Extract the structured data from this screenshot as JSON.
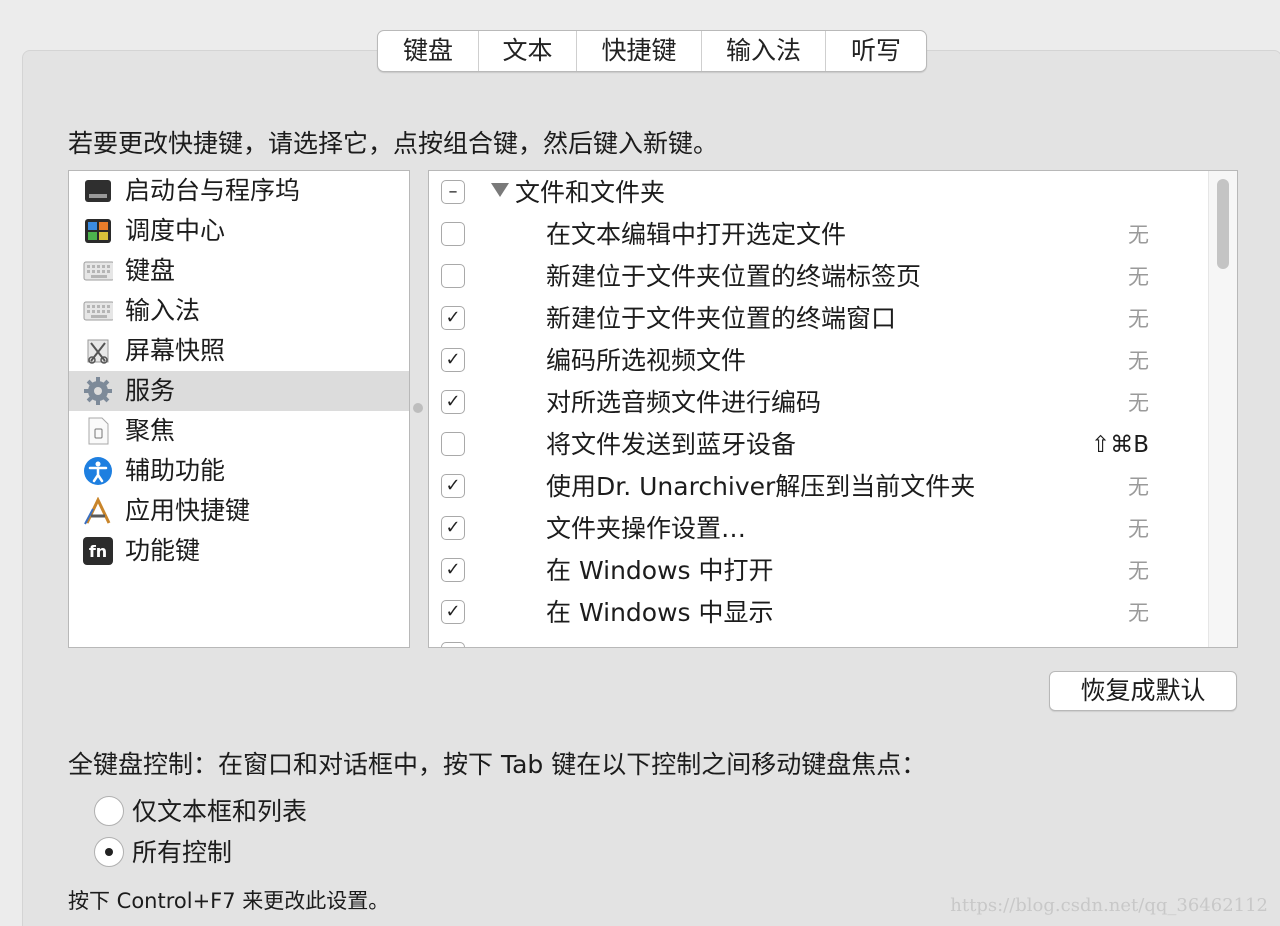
{
  "tabs": [
    {
      "label": "键盘",
      "selected": false
    },
    {
      "label": "文本",
      "selected": false
    },
    {
      "label": "快捷键",
      "selected": true
    },
    {
      "label": "输入法",
      "selected": false
    },
    {
      "label": "听写",
      "selected": false
    }
  ],
  "instruction": "若要更改快捷键，请选择它，点按组合键，然后键入新键。",
  "categories": [
    {
      "label": "启动台与程序坞",
      "icon": "launchpad-dock-icon",
      "icon_color": "#333333",
      "selected": false
    },
    {
      "label": "调度中心",
      "icon": "mission-control-icon",
      "icon_color": "#2e2e2e",
      "selected": false
    },
    {
      "label": "键盘",
      "icon": "keyboard-icon",
      "icon_color": "#c9c9c9",
      "selected": false
    },
    {
      "label": "输入法",
      "icon": "input-method-icon",
      "icon_color": "#c9c9c9",
      "selected": false
    },
    {
      "label": "屏幕快照",
      "icon": "screenshot-icon",
      "icon_color": "#b0b0b0",
      "selected": false
    },
    {
      "label": "服务",
      "icon": "gear-icon",
      "icon_color": "#8a8a8a",
      "selected": true
    },
    {
      "label": "聚焦",
      "icon": "spotlight-icon",
      "icon_color": "#dddddd",
      "selected": false
    },
    {
      "label": "辅助功能",
      "icon": "accessibility-icon",
      "icon_color": "#1e7fe0",
      "selected": false
    },
    {
      "label": "应用快捷键",
      "icon": "app-shortcuts-icon",
      "icon_color": "#e0a030",
      "selected": false
    },
    {
      "label": "功能键",
      "icon": "fn-key-icon",
      "icon_color": "#2c2c2c",
      "selected": false
    }
  ],
  "services": {
    "group": {
      "label": "文件和文件夹",
      "state": "mixed",
      "expanded": true
    },
    "items": [
      {
        "label": "在文本编辑中打开选定文件",
        "checked": false,
        "shortcut": "无",
        "set": false
      },
      {
        "label": "新建位于文件夹位置的终端标签页",
        "checked": false,
        "shortcut": "无",
        "set": false
      },
      {
        "label": "新建位于文件夹位置的终端窗口",
        "checked": true,
        "shortcut": "无",
        "set": false
      },
      {
        "label": "编码所选视频文件",
        "checked": true,
        "shortcut": "无",
        "set": false
      },
      {
        "label": "对所选音频文件进行编码",
        "checked": true,
        "shortcut": "无",
        "set": false
      },
      {
        "label": "将文件发送到蓝牙设备",
        "checked": false,
        "shortcut": "⇧⌘B",
        "set": true
      },
      {
        "label": "使用Dr. Unarchiver解压到当前文件夹",
        "checked": true,
        "shortcut": "无",
        "set": false
      },
      {
        "label": "文件夹操作设置…",
        "checked": true,
        "shortcut": "无",
        "set": false
      },
      {
        "label": "在 Windows 中打开",
        "checked": true,
        "shortcut": "无",
        "set": false
      },
      {
        "label": "在 Windows 中显示",
        "checked": true,
        "shortcut": "无",
        "set": false
      }
    ]
  },
  "restore_button": "恢复成默认",
  "keyboard_control": {
    "title": "全键盘控制：在窗口和对话框中，按下 Tab 键在以下控制之间移动键盘焦点：",
    "options": [
      {
        "label": "仅文本框和列表",
        "checked": false
      },
      {
        "label": "所有控制",
        "checked": true
      }
    ]
  },
  "footnote": "按下 Control+F7 来更改此设置。",
  "watermark": "https://blog.csdn.net/qq_36462112",
  "check_glyph": "✓",
  "mixed_glyph": "–"
}
